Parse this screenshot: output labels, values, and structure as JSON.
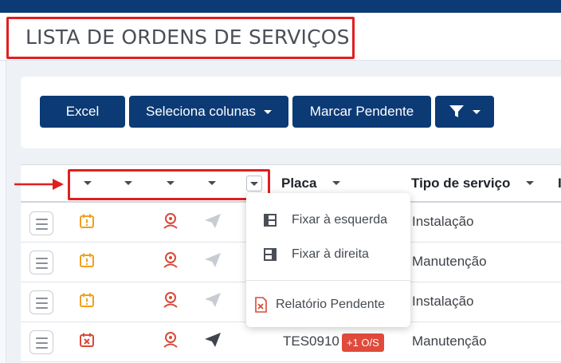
{
  "page": {
    "title": "LISTA DE ORDENS DE SERVIÇOS"
  },
  "toolbar": {
    "excel_label": "Excel",
    "columns_label": "Seleciona colunas",
    "pending_label": "Marcar Pendente",
    "filter_icon": "funnel-icon"
  },
  "table": {
    "headers": {
      "placa": "Placa",
      "tipo": "Tipo de serviço"
    },
    "rows": [
      {
        "status_icon": "calendar-alert-icon",
        "status_color": "#f0a020",
        "driver_icon": "driver-icon",
        "send_icon": "send-icon",
        "send_color": "#c8ccd2",
        "placa": "",
        "tipo": "Instalação"
      },
      {
        "status_icon": "calendar-alert-icon",
        "status_color": "#f0a020",
        "driver_icon": "driver-icon",
        "send_icon": "send-icon",
        "send_color": "#c8ccd2",
        "placa": "",
        "tipo": "Manutenção"
      },
      {
        "status_icon": "calendar-alert-icon",
        "status_color": "#f0a020",
        "driver_icon": "driver-icon",
        "send_icon": "send-icon",
        "send_color": "#c8ccd2",
        "placa": "",
        "tipo": "Instalação"
      },
      {
        "status_icon": "calendar-cancel-icon",
        "status_color": "#d84a3a",
        "driver_icon": "driver-icon",
        "send_icon": "send-icon",
        "send_color": "#40454d",
        "placa": "TES0910",
        "badge": "+1 O/S",
        "tipo": "Manutenção"
      }
    ]
  },
  "dropdown": {
    "items": [
      {
        "label": "Fixar à esquerda",
        "icon": "pin-left-icon"
      },
      {
        "label": "Fixar à direita",
        "icon": "pin-right-icon"
      },
      {
        "label": "Relatório Pendente",
        "icon": "report-pending-icon"
      }
    ]
  },
  "colors": {
    "primary": "#0c3a75",
    "highlight": "#e01f1f",
    "warning": "#f0a020",
    "danger": "#d84a3a"
  }
}
